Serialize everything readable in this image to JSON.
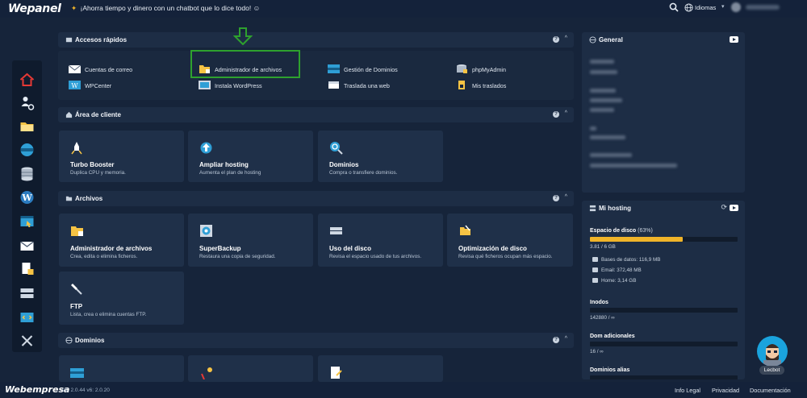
{
  "topbar": {
    "logo": "Wepanel",
    "promo": "¡Ahorra tiempo y dinero con un chatbot que lo dice todo!",
    "language": "Idiomas"
  },
  "quick_access": {
    "title": "Accesos rápidos",
    "links": [
      {
        "label": "Cuentas de correo",
        "icon": "mail-icon"
      },
      {
        "label": "Administrador de archivos",
        "icon": "folder-icon"
      },
      {
        "label": "Gestión de Dominios",
        "icon": "domain-icon"
      },
      {
        "label": "phpMyAdmin",
        "icon": "database-icon"
      },
      {
        "label": "WPCenter",
        "icon": "wordpress-icon"
      },
      {
        "label": "Instala WordPress",
        "icon": "install-icon"
      },
      {
        "label": "Traslada una web",
        "icon": "transfer-icon"
      },
      {
        "label": "Mis traslados",
        "icon": "box-icon"
      }
    ]
  },
  "client_area": {
    "title": "Área de cliente",
    "tiles": [
      {
        "title": "Turbo Booster",
        "desc": "Duplica CPU y memoria."
      },
      {
        "title": "Ampliar hosting",
        "desc": "Aumenta el plan de hosting"
      },
      {
        "title": "Dominios",
        "desc": "Compra o transfiere dominios."
      }
    ]
  },
  "files": {
    "title": "Archivos",
    "tiles": [
      {
        "title": "Administrador de archivos",
        "desc": "Crea, edita o elimina ficheros."
      },
      {
        "title": "SuperBackup",
        "desc": "Restaura una copia de seguridad."
      },
      {
        "title": "Uso del disco",
        "desc": "Revisa el espacio usado de tus archivos."
      },
      {
        "title": "Optimización de disco",
        "desc": "Revisa qué ficheros ocupan más espacio."
      },
      {
        "title": "FTP",
        "desc": "Lista, crea o elimina cuentas FTP."
      }
    ]
  },
  "domains": {
    "title": "Dominios"
  },
  "general": {
    "title": "General"
  },
  "hosting": {
    "title": "Mi hosting",
    "disk_label": "Espacio de disco",
    "disk_pct_label": "(63%)",
    "disk_fraction": 0.63,
    "disk_value": "3.81 / 6 GB",
    "db_label": "Bases de datos: 116,9 MB",
    "email_label": "Email: 372,48 MB",
    "home_label": "Home: 3,14 GB",
    "inodes_label": "Inodos",
    "inodes_value": "142880 / ∞",
    "addon_label": "Dom adicionales",
    "addon_value": "16 / ∞",
    "alias_label": "Dominios alias"
  },
  "footer": {
    "logo": "Webempresa",
    "version": "v1: 2.0.44 v6: 2.0.20",
    "links": [
      "Info Legal",
      "Privacidad",
      "Documentación"
    ]
  },
  "bot": {
    "label": "Lecbot"
  },
  "colors": {
    "accent": "#f0b429",
    "highlight": "#2ea12e",
    "background": "#16243a",
    "card": "#1d2d45"
  }
}
